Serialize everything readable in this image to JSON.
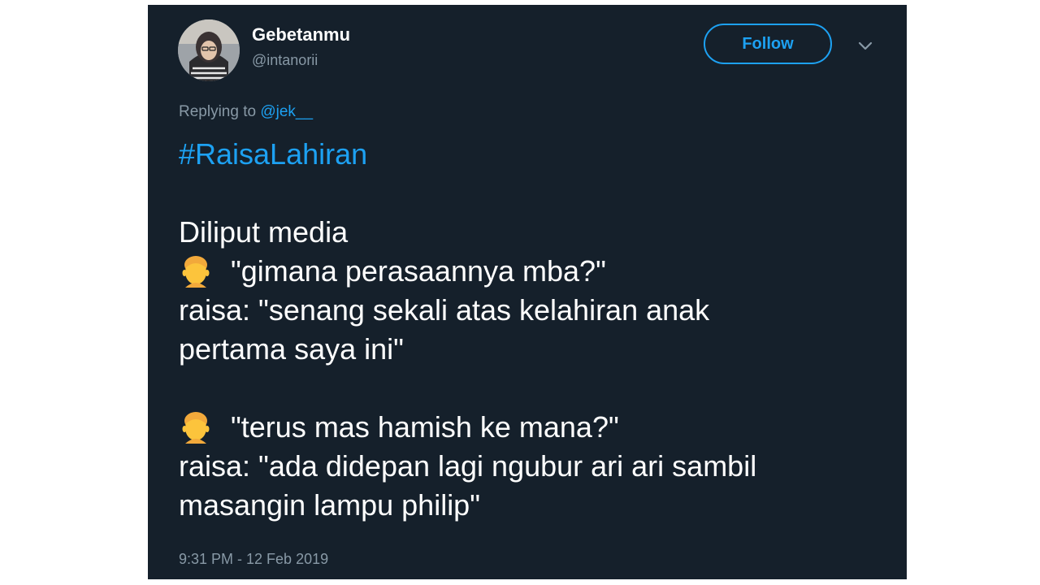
{
  "user": {
    "display_name": "Gebetanmu",
    "handle": "@intanorii",
    "avatar_icon": "avatar-photo"
  },
  "actions": {
    "follow_label": "Follow",
    "caret_icon": "chevron-down-icon"
  },
  "reply": {
    "prefix": "Replying to",
    "mention": "@jek__"
  },
  "tweet": {
    "hashtag": "#RaisaLahiran",
    "line_1": "Diliput media",
    "line_2": "\"gimana perasaannya mba?\"",
    "line_3": "raisa: \"senang sekali atas kelahiran anak",
    "line_4": "pertama saya ini\"",
    "line_5": "\"terus mas hamish ke mana?\"",
    "line_6": "raisa: \"ada didepan lagi ngubur ari ari sambil",
    "line_7": "masangin lampu philip\"",
    "emoji_icon": "man-emoji-icon"
  },
  "timestamp": "9:31 PM - 12 Feb 2019",
  "colors": {
    "background": "#15202b",
    "accent": "#1da1f2",
    "secondary_text": "#8899a6"
  }
}
